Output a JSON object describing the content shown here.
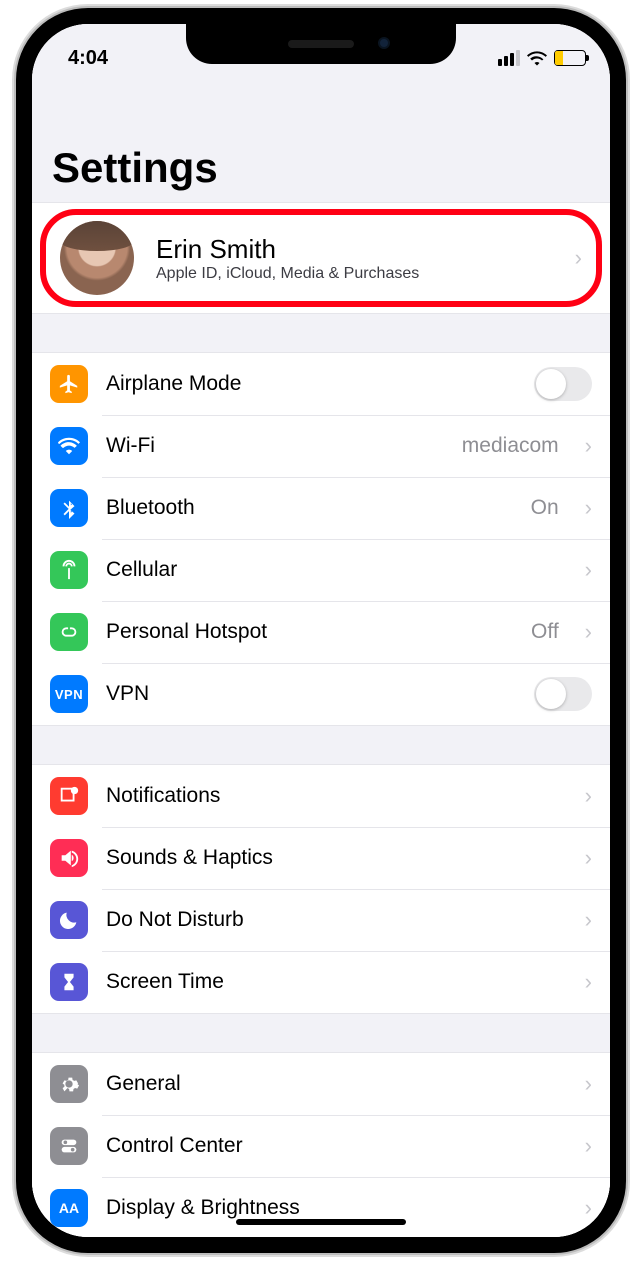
{
  "status": {
    "time": "4:04"
  },
  "title": "Settings",
  "profile": {
    "name": "Erin Smith",
    "subtitle": "Apple ID, iCloud, Media & Purchases"
  },
  "group1": {
    "airplane": {
      "label": "Airplane Mode"
    },
    "wifi": {
      "label": "Wi-Fi",
      "value": "mediacom"
    },
    "bluetooth": {
      "label": "Bluetooth",
      "value": "On"
    },
    "cellular": {
      "label": "Cellular"
    },
    "hotspot": {
      "label": "Personal Hotspot",
      "value": "Off"
    },
    "vpn": {
      "label": "VPN",
      "badge": "VPN"
    }
  },
  "group2": {
    "notifications": {
      "label": "Notifications"
    },
    "sounds": {
      "label": "Sounds & Haptics"
    },
    "dnd": {
      "label": "Do Not Disturb"
    },
    "screentime": {
      "label": "Screen Time"
    }
  },
  "group3": {
    "general": {
      "label": "General"
    },
    "controlcenter": {
      "label": "Control Center"
    },
    "display": {
      "label": "Display & Brightness"
    }
  }
}
